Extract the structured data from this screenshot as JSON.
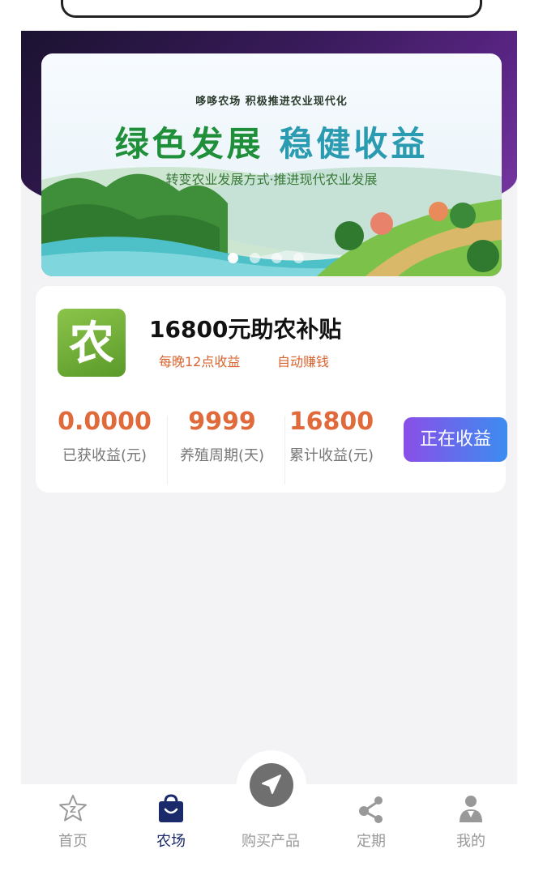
{
  "banner": {
    "subtitle": "哆哆农场 积极推进农业现代化",
    "title_part1": "绿色发展",
    "title_part2": "稳健收益",
    "slogan": "转变农业发展方式·推进现代农业发展",
    "active_dot": 0,
    "dot_count": 4
  },
  "product": {
    "icon_name": "farm-app-icon",
    "title": "16800元助农补贴",
    "tags": [
      "每晚12点收益",
      "自动赚钱"
    ],
    "stats": [
      {
        "value": "0.0000",
        "label": "已获收益(元)"
      },
      {
        "value": "9999",
        "label": "养殖周期(天)"
      },
      {
        "value": "16800",
        "label": "累计收益(元)"
      }
    ],
    "button_label": "正在收益"
  },
  "tabbar": {
    "items": [
      {
        "label": "首页",
        "icon": "home-star-icon"
      },
      {
        "label": "农场",
        "icon": "shopping-bag-icon",
        "active": true
      },
      {
        "label": "购买产品",
        "icon": "navigation-arrow-icon"
      },
      {
        "label": "定期",
        "icon": "share-nodes-icon"
      },
      {
        "label": "我的",
        "icon": "user-icon"
      }
    ]
  },
  "colors": {
    "accent_orange": "#e06a3a",
    "tab_active": "#1a2a6a",
    "button_gradient_start": "#8a4ee8",
    "button_gradient_end": "#3c8df0"
  }
}
